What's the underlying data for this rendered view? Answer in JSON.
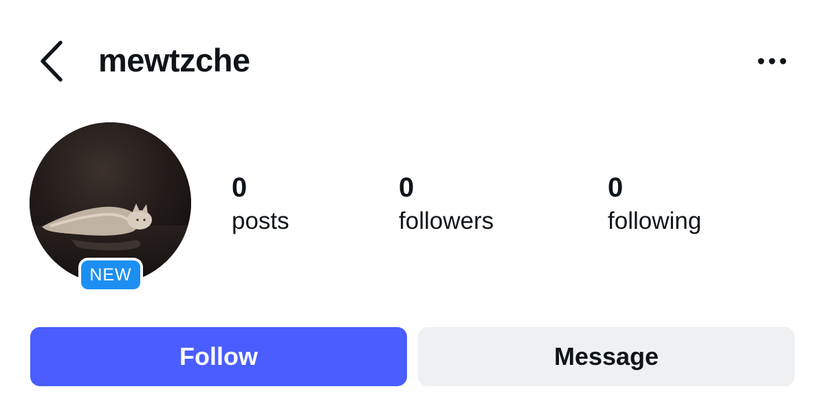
{
  "header": {
    "username": "mewtzche",
    "back_icon": "chevron-left-icon",
    "more_icon": "ellipsis-icon"
  },
  "profile": {
    "avatar_description": "cat-photo",
    "badge": "NEW",
    "badge_color": "#1d8ff2"
  },
  "stats": [
    {
      "count": "0",
      "label": "posts"
    },
    {
      "count": "0",
      "label": "followers"
    },
    {
      "count": "0",
      "label": "following"
    }
  ],
  "actions": {
    "follow_label": "Follow",
    "follow_color": "#4a5dff",
    "message_label": "Message",
    "message_color": "#eef0f2"
  }
}
